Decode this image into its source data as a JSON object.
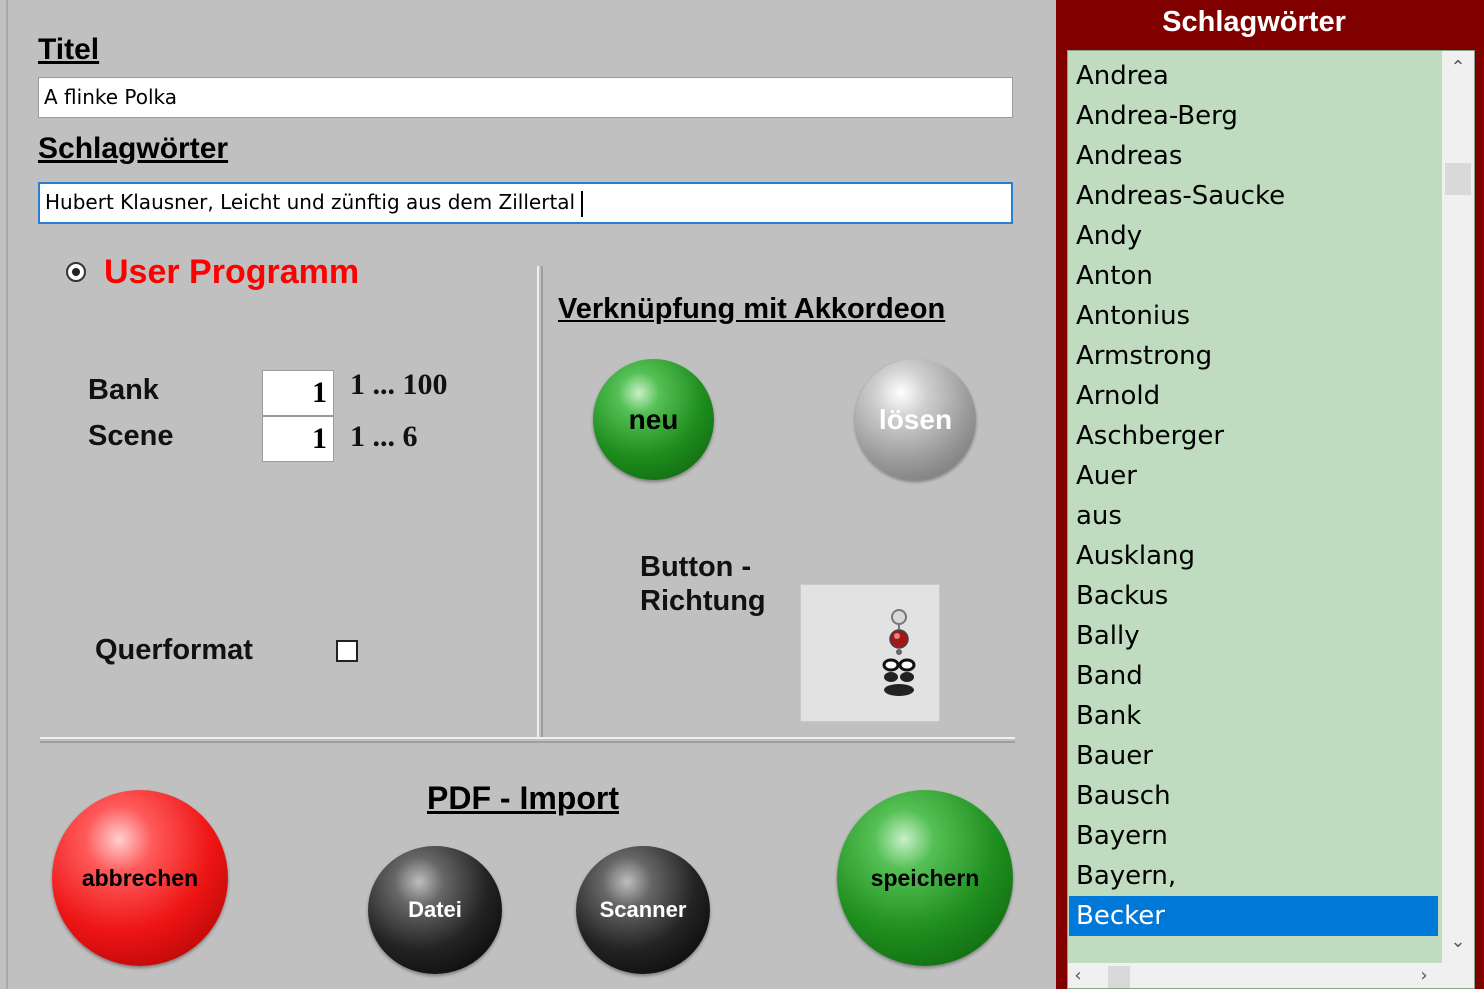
{
  "form": {
    "title_label": "Titel",
    "title_value": "A flinke Polka",
    "keywords_label": "Schlagwörter",
    "keywords_value": "Hubert Klausner, Leicht und zünftig aus dem Zillertal",
    "user_program_label": "User Programm",
    "bank_label": "Bank",
    "bank_value": "1",
    "bank_range": "1 ... 100",
    "scene_label": "Scene",
    "scene_value": "1",
    "scene_range": "1 ... 6",
    "querformat_label": "Querformat",
    "querformat_checked": false
  },
  "accordion_link": {
    "title": "Verknüpfung mit Akkordeon",
    "new_label": "neu",
    "release_label": "lösen",
    "direction_label_line1": "Button -",
    "direction_label_line2": "Richtung"
  },
  "pdf_import": {
    "title": "PDF - Import",
    "file_label": "Datei",
    "scanner_label": "Scanner"
  },
  "actions": {
    "cancel_label": "abbrechen",
    "save_label": "speichern"
  },
  "keywords_panel": {
    "title": "Schlagwörter",
    "items": [
      "Andrea",
      "Andrea-Berg",
      "Andreas",
      "Andreas-Saucke",
      "Andy",
      "Anton",
      "Antonius",
      "Armstrong",
      "Arnold",
      "Aschberger",
      "Auer",
      "aus",
      "Ausklang",
      "Backus",
      "Bally",
      "Band",
      "Bank",
      "Bauer",
      "Bausch",
      "Bayern",
      "Bayern,",
      "Becker"
    ],
    "selected_item": "Becker"
  },
  "colors": {
    "panel_bg": "#c0c0c0",
    "sidebar_bg": "#800000",
    "list_bg": "#c0dcc0",
    "selection": "#0078d7",
    "accent_red": "#ff0000"
  },
  "icons": {
    "direction_icon": "accordion-button-direction-icon",
    "scroll_up": "chevron-up-icon",
    "scroll_down": "chevron-down-icon",
    "scroll_left": "chevron-left-icon",
    "scroll_right": "chevron-right-icon"
  }
}
